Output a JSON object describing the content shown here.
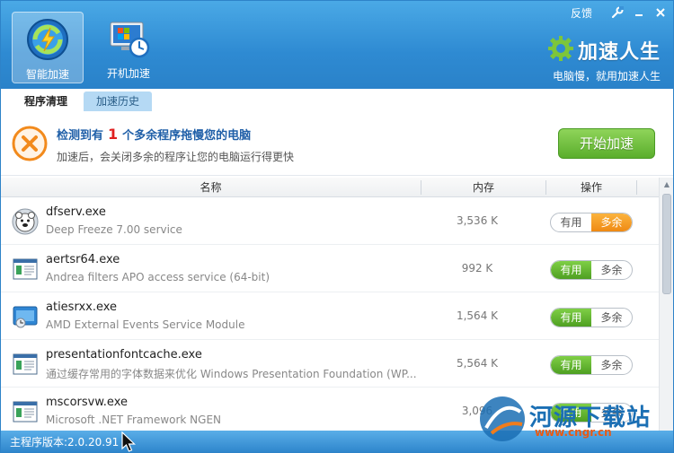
{
  "window": {
    "feedback_label": "反馈",
    "brand_title": "加速人生",
    "brand_slogan": "电脑慢，就用加速人生"
  },
  "nav": {
    "smart_accel": "智能加速",
    "boot_accel": "开机加速"
  },
  "tabs": [
    {
      "label": "程序清理"
    },
    {
      "label": "加速历史"
    }
  ],
  "alert": {
    "prefix": "检测到有",
    "count": "1",
    "suffix": "个多余程序拖慢您的电脑",
    "subtitle": "加速后，会关闭多余的程序让您的电脑运行得更快",
    "start_button": "开始加速"
  },
  "table": {
    "columns": [
      "名称",
      "内存",
      "操作"
    ],
    "toggle_useful": "有用",
    "toggle_extra": "多余",
    "rows": [
      {
        "name": "dfserv.exe",
        "desc": "Deep Freeze 7.00 service",
        "mem": "3,536 K",
        "state": "多余"
      },
      {
        "name": "aertsr64.exe",
        "desc": "Andrea filters APO access service (64-bit)",
        "mem": "992 K",
        "state": "有用"
      },
      {
        "name": "atiesrxx.exe",
        "desc": "AMD External Events Service Module",
        "mem": "1,564 K",
        "state": "有用"
      },
      {
        "name": "presentationfontcache.exe",
        "desc": "通过缓存常用的字体数据来优化 Windows Presentation Foundation (WP...",
        "mem": "5,564 K",
        "state": "有用"
      },
      {
        "name": "mscorsvw.exe",
        "desc": "Microsoft .NET Framework NGEN",
        "mem": "3,096",
        "state": "有用"
      }
    ]
  },
  "status": {
    "version": "主程序版本:2.0.20.91"
  },
  "watermark": {
    "title": "河源下载站",
    "url": "www.cngr.cn"
  }
}
